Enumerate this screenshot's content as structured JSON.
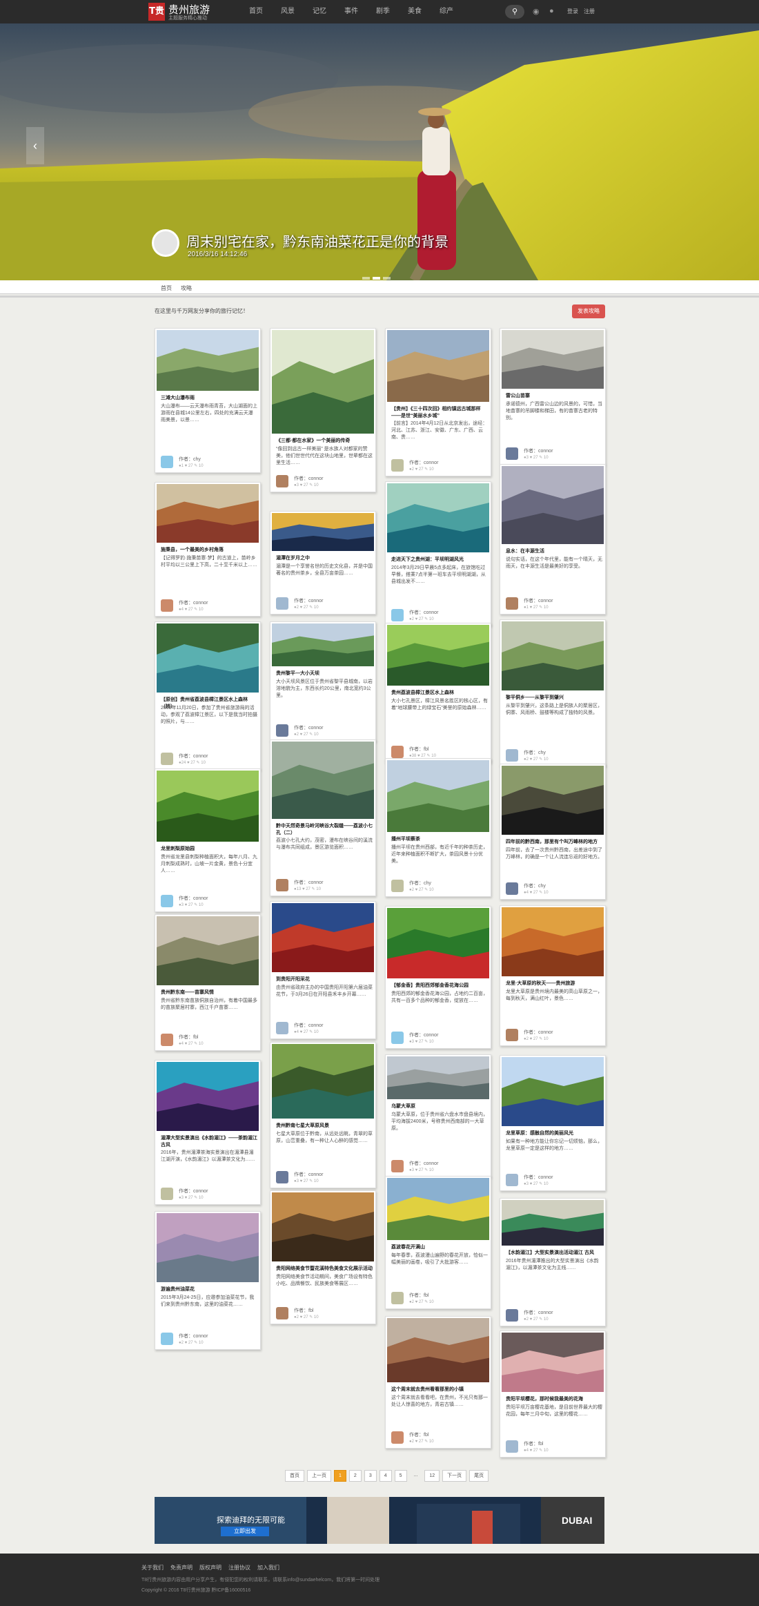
{
  "site": {
    "logo_text": "T贵",
    "name": "贵州旅游",
    "subtitle": "主题服务精心推动"
  },
  "nav": {
    "items": [
      "首页",
      "风景",
      "记忆",
      "事件",
      "剧季",
      "美食",
      "综产"
    ],
    "search_icon": "search-icon",
    "login_label": "登录",
    "register_label": "注册"
  },
  "hero": {
    "title": "周末别宅在家，黔东南油菜花正是你的背景",
    "date": "2016/3/16 14:12:46",
    "slide_count": 3,
    "active_slide": 2
  },
  "subnav": {
    "items": [
      "首页",
      "攻略"
    ]
  },
  "intro": {
    "text": "在这里与千万网友分享你的旅行记忆！",
    "button": "发表攻略"
  },
  "cards": [
    {
      "title": "三滩大山瀑布雨",
      "excerpt": "大山瀑布——云天瀑布雨青苔，大山湖面的上游雨在县城14公里左右，四处的充满云天瀑雨美景，以景……",
      "author": "作者：chy",
      "stats": "●1 ♥ 27 ✎ 10"
    },
    {
      "title": "《三都·都在水家》一个美丽的传奇",
      "excerpt": "“像回到远古一样美丽” 是水族人对都家的赞美，他们世世代代在这块山地里，世辈都在这里生活……",
      "author": "作者：connor",
      "stats": "●3 ♥ 27 ✎ 10"
    },
    {
      "title": "【贵州】《三十四次回》相约镇远古城那样——是世“美丽水乡城”",
      "excerpt": "【前言】2014年4月12日从北京发出，途经：河北、江苏、浙江、安徽、广东、广西、云南、贵……",
      "author": "作者：connor",
      "stats": "●2 ♥ 27 ✎ 10"
    },
    {
      "title": "雷公山苗寨",
      "excerpt": "承诺德州，广西雷公山边的风景的，可惜，当地苗寨的吊脚楼和梯田，有的苗寨古老的特别。",
      "author": "作者：connor",
      "stats": "●3 ♥ 27 ✎ 10"
    },
    {
      "title": "施秉县，一个最美的乡村角落",
      "excerpt": "【记得罗豹·施秉苗寨·梦】的古道上，苗岭乡村平均以三公里上下高，二十至千米以上……",
      "author": "作者：connor",
      "stats": "●4 ♥ 27 ✎ 10"
    },
    {
      "title": "湄潭在岁月之中",
      "excerpt": "湄潭是一个享誉名世的历史文化县，并是中国著名的贵州茶乡，全县万亩茶园……",
      "author": "作者：connor",
      "stats": "●2 ♥ 27 ✎ 10"
    },
    {
      "title": "走进天下之贵州湖：平坝明湖风光",
      "excerpt": "2014年3月29日早晨5点多起床，在旅馆吃过早餐，搭乘7点半第一班车去平坝明湖湖，从县城出发不……",
      "author": "作者：connor",
      "stats": "●2 ♥ 27 ✎ 10"
    },
    {
      "title": "息水：在丰源生活",
      "excerpt": "说句实话，在这个年代里，能有一个晴天，无雨天，在丰源生活是最美好的享受。",
      "author": "作者：connor",
      "stats": "●1 ♥ 27 ✎ 10"
    },
    {
      "title": "【原创】贵州省荔波县樟江景区水上森林（转）",
      "excerpt": "2009年11月20日，参加了贵州省旅游局的活动，参观了荔波樟江景区，以下是我当时拍摄的照片，与……",
      "author": "作者：connor",
      "stats": "●24 ♥ 27 ✎ 10"
    },
    {
      "title": "贵州黎平—大小天坝",
      "excerpt": "大小天坝风景区位于贵州省黎平县城南，以岩溶地貌为主，东西长约20公里，南北宽约3公里。",
      "author": "作者：connor",
      "stats": "●2 ♥ 27 ✎ 10"
    },
    {
      "title": "贵州荔波县樟江景区水上森林",
      "excerpt": "大小七孔景区，樟江风景名胜区的核心区，有着“地球腰带上的绿宝石”美誉的原始森林……",
      "author": "作者：fbl",
      "stats": "●38 ♥ 27 ✎ 10"
    },
    {
      "title": "黎平侗乡——从黎平到肇兴",
      "excerpt": "从黎平到肇兴，这条路上是侗族人的聚居区，侗寨、风雨桥、鼓楼等构成了独特的风景。",
      "author": "作者：chy",
      "stats": "●2 ♥ 27 ✎ 10"
    },
    {
      "title": "龙里刺梨原始园",
      "excerpt": "贵州省龙里县刺梨种植面积大，每年八月、九月刺梨成熟时，山坡一片金黄，景色十分宜人……",
      "author": "作者：connor",
      "stats": "●3 ♥ 27 ✎ 10"
    },
    {
      "title": "黔中天然奇景马岭河峡谷大裂缝——荔波小七孔（二）",
      "excerpt": "荔波小七孔大约，茂密，漫布在峡谷间的溪流与瀑布共同组成，景区游览面积……",
      "author": "作者：connor",
      "stats": "●13 ♥ 27 ✎ 10"
    },
    {
      "title": "播州平坝蔡茶",
      "excerpt": "播州平坝在贵州西部，有近千年的种茶历史，近年来种植面积不断扩大，茶园风景十分优美。",
      "author": "作者：chy",
      "stats": "●2 ♥ 27 ✎ 10"
    },
    {
      "title": "四年前的黔西南，那里有个叫万峰林的地方",
      "excerpt": "四年前，去了一次贵州黔西南，出差途中到了万峰林，的确是一个让人流连忘返的好地方。",
      "author": "作者：chy",
      "stats": "●4 ♥ 27 ✎ 10"
    },
    {
      "title": "贵州黔东南——苗寨风情",
      "excerpt": "贵州省黔东南苗族侗族自治州，有着中国最多的苗族聚居村寨，西江千户苗寨……",
      "author": "作者：fbl",
      "stats": "●4 ♥ 27 ✎ 10"
    },
    {
      "title": "到贵阳开阳采花",
      "excerpt": "由贵州省政府主办的中国贵阳开阳第六届油菜花节，于3月26日在开阳县禾丰乡开幕……",
      "author": "作者：connor",
      "stats": "●4 ♥ 27 ✎ 10"
    },
    {
      "title": "【郁金香】贵阳西郊郁金香花海公园",
      "excerpt": "贵阳西郊的郁金香花海公园，占地约二百亩，共有一百多个品种的郁金香，绽放在……",
      "author": "作者：connor",
      "stats": "●3 ♥ 27 ✎ 10"
    },
    {
      "title": "龙里·大草原的秋天——贵州旅游",
      "excerpt": "龙里大草原是贵州境内最美的高山草原之一，每到秋天，满山红叶，景色……",
      "author": "作者：connor",
      "stats": "●2 ♥ 27 ✎ 10"
    },
    {
      "title": "湄潭大型实景演出《水韵湄江》——茶韵湄江 古风",
      "excerpt": "2016年，贵州湄潭茶海实景演出在湄潭县湄江湖开演，《水韵湄江》以湄潭茶文化为……",
      "author": "作者：connor",
      "stats": "●3 ♥ 27 ✎ 10"
    },
    {
      "title": "贵州黔南七星大草原风景",
      "excerpt": "七星大草原位于黔南，从远处远眺，青翠的草原，山峦重叠，有一种让人心醉的感觉……",
      "author": "作者：connor",
      "stats": "●3 ♥ 27 ✎ 10"
    },
    {
      "title": "乌蒙大草原",
      "excerpt": "乌蒙大草原，位于贵州省六盘水市盘县境内，平均海拔2400米，号称贵州西南部的一大草原。",
      "author": "作者：connor",
      "stats": "●3 ♥ 27 ✎ 10"
    },
    {
      "title": "龙里草原：感触自然的美丽风光",
      "excerpt": "如果有一种地方能让你忘记一切烦恼，那么，龙里草原一定是这样的地方……",
      "author": "作者：connor",
      "stats": "●3 ♥ 27 ✎ 10"
    },
    {
      "title": "游遍贵州油菜花",
      "excerpt": "2015年3月24-25日，应邀参加油菜花节，我们来到贵州黔东南，这里的油菜花……",
      "author": "作者：connor",
      "stats": "●2 ♥ 27 ✎ 10"
    },
    {
      "title": "贵阳网络美食节暨花溪特色美食文化展示活动",
      "excerpt": "贵阳网络美食节活动期间，美食广场设有特色小吃、品牌餐饮、民族美食等展区……",
      "author": "作者：fbl",
      "stats": "●2 ♥ 27 ✎ 10"
    },
    {
      "title": "荔波春花开满山",
      "excerpt": "每年春季，荔波漫山遍野的春花开放，恰似一幅美丽的画卷，吸引了大批游客……",
      "author": "作者：fbl",
      "stats": "●2 ♥ 27 ✎ 10"
    },
    {
      "title": "【水韵湄江】大型实景演出活动湄江 古风",
      "excerpt": "2016年贵州湄潭推出的大型实景演出《水韵湄江》，以湄潭茶文化为主线……",
      "author": "作者：connor",
      "stats": "●2 ♥ 27 ✎ 10"
    },
    {
      "title": "这个周末就去贵州看看那里的小镇",
      "excerpt": "这个周末就去看看吧，在贵州，不光只有那一处让人惊喜的地方，青岩古镇……",
      "author": "作者：fbl",
      "stats": "●2 ♥ 27 ✎ 10"
    },
    {
      "title": "贵阳平坝樱花，那时候我最美的花海",
      "excerpt": "贵阳平坝万亩樱花基地，是目前世界最大的樱花园，每年三月中旬，这里的樱花……",
      "author": "作者：fbl",
      "stats": "●4 ♥ 27 ✎ 10"
    }
  ],
  "pager": {
    "items": [
      "首页",
      "上一页",
      "1",
      "2",
      "3",
      "4",
      "5",
      "...",
      "12",
      "下一页",
      "尾页"
    ],
    "current": "1"
  },
  "ad": {
    "search_text": "探索迪拜的无限可能",
    "button": "立即出发",
    "logo": "DUBAI"
  },
  "footer": {
    "links": [
      "关于我们",
      "免责声明",
      "版权声明",
      "注册协议",
      "加入我们"
    ],
    "line1": "T8行贵州旅游内容由用户分享产生，有侵犯您的权利请联系，请联系info@sundaehelcom，我们将第一时间处理",
    "line2": "Copyright © 2016 T8行贵州旅游 黔ICP备16000516"
  },
  "colors": {
    "nav_bg": "#2b2b2b",
    "accent_red": "#d9534f",
    "pager_current": "#f0a020",
    "page_bg": "#eeeeea"
  }
}
